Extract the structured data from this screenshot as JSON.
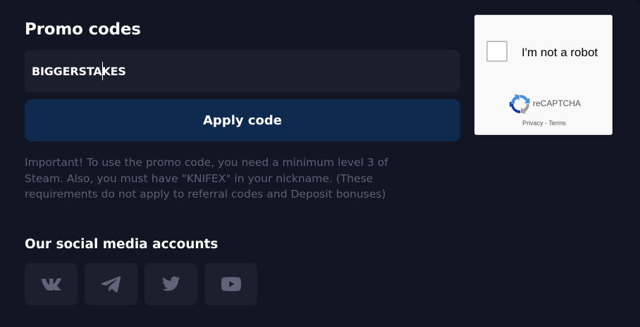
{
  "promo": {
    "title": "Promo codes",
    "input_value": "BIGGERSTAKES",
    "apply_label": "Apply code",
    "notice": "Important! To use the promo code, you need a minimum level 3 of Steam. Also, you must have \"KNIFEX\" in your nickname. (These requirements do not apply to referral codes and Deposit bonuses)"
  },
  "social": {
    "title": "Our social media accounts",
    "items": [
      {
        "icon": "vk-icon"
      },
      {
        "icon": "telegram-icon"
      },
      {
        "icon": "twitter-icon"
      },
      {
        "icon": "youtube-icon"
      }
    ]
  },
  "recaptcha": {
    "label": "I'm not a robot",
    "brand": "reCAPTCHA",
    "privacy": "Privacy",
    "separator": " - ",
    "terms": "Terms"
  },
  "colors": {
    "background": "#121523",
    "input_bg": "#1b1e2c",
    "button_bg": "#0e2a4f",
    "muted_text": "#5b6074",
    "social_icon": "#5f6478"
  }
}
